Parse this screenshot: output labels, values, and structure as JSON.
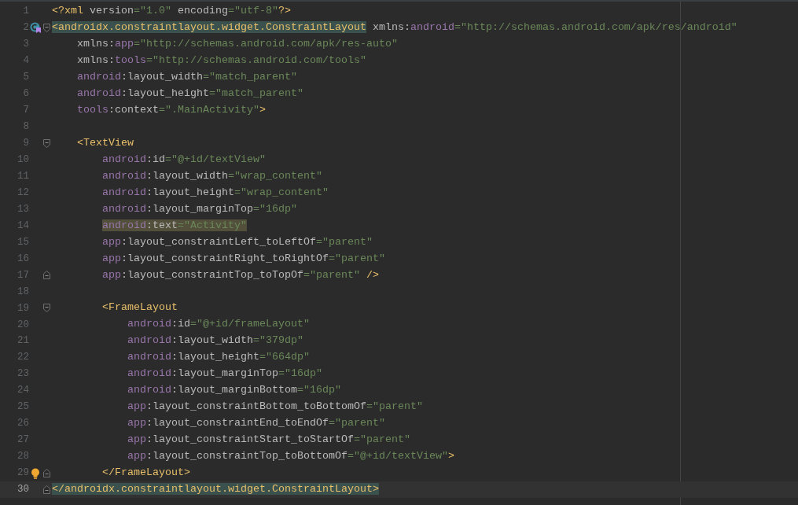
{
  "editor": {
    "lines": [
      {
        "number": "1",
        "current": false,
        "tokens": [
          {
            "kind": "tag",
            "text": "<?xml"
          },
          {
            "kind": "attr",
            "text": " version"
          },
          {
            "kind": "eq",
            "text": "="
          },
          {
            "kind": "str",
            "text": "\"1.0\""
          },
          {
            "kind": "attr",
            "text": " encoding"
          },
          {
            "kind": "eq",
            "text": "="
          },
          {
            "kind": "str",
            "text": "\"utf-8\""
          },
          {
            "kind": "tag",
            "text": "?>"
          }
        ]
      },
      {
        "number": "2",
        "current": false,
        "implemented": true,
        "fold_open": true,
        "tokens": [
          {
            "kind": "tag",
            "text": "<androidx.constraintlayout.widget.ConstraintLayout",
            "matched": true
          },
          {
            "kind": "attr",
            "text": " xmlns:"
          },
          {
            "kind": "ns",
            "text": "android"
          },
          {
            "kind": "eq",
            "text": "="
          },
          {
            "kind": "str",
            "text": "\"http://schemas.android.com/apk/res/android\""
          }
        ]
      },
      {
        "number": "3",
        "current": false,
        "tokens": [
          {
            "kind": "attr",
            "text": "    xmlns:"
          },
          {
            "kind": "ns",
            "text": "app"
          },
          {
            "kind": "eq",
            "text": "="
          },
          {
            "kind": "str",
            "text": "\"http://schemas.android.com/apk/res-auto\""
          }
        ]
      },
      {
        "number": "4",
        "current": false,
        "tokens": [
          {
            "kind": "attr",
            "text": "    xmlns:"
          },
          {
            "kind": "ns",
            "text": "tools"
          },
          {
            "kind": "eq",
            "text": "="
          },
          {
            "kind": "str",
            "text": "\"http://schemas.android.com/tools\""
          }
        ]
      },
      {
        "number": "5",
        "current": false,
        "tokens": [
          {
            "kind": "ns",
            "text": "    android"
          },
          {
            "kind": "attr",
            "text": ":layout_width"
          },
          {
            "kind": "eq",
            "text": "="
          },
          {
            "kind": "str",
            "text": "\"match_parent\""
          }
        ]
      },
      {
        "number": "6",
        "current": false,
        "tokens": [
          {
            "kind": "ns",
            "text": "    android"
          },
          {
            "kind": "attr",
            "text": ":layout_height"
          },
          {
            "kind": "eq",
            "text": "="
          },
          {
            "kind": "str",
            "text": "\"match_parent\""
          }
        ]
      },
      {
        "number": "7",
        "current": false,
        "tokens": [
          {
            "kind": "ns",
            "text": "    tools"
          },
          {
            "kind": "attr",
            "text": ":context"
          },
          {
            "kind": "eq",
            "text": "="
          },
          {
            "kind": "str",
            "text": "\".MainActivity\""
          },
          {
            "kind": "tag",
            "text": ">"
          }
        ]
      },
      {
        "number": "8",
        "current": false
      },
      {
        "number": "9",
        "current": false,
        "fold_open": true,
        "tokens": [
          {
            "kind": "tag",
            "text": "    <TextView"
          }
        ]
      },
      {
        "number": "10",
        "current": false,
        "tokens": [
          {
            "kind": "ns",
            "text": "        android"
          },
          {
            "kind": "attr",
            "text": ":id"
          },
          {
            "kind": "eq",
            "text": "="
          },
          {
            "kind": "str",
            "text": "\"@+id/textView\""
          }
        ]
      },
      {
        "number": "11",
        "current": false,
        "tokens": [
          {
            "kind": "ns",
            "text": "        android"
          },
          {
            "kind": "attr",
            "text": ":layout_width"
          },
          {
            "kind": "eq",
            "text": "="
          },
          {
            "kind": "str",
            "text": "\"wrap_content\""
          }
        ]
      },
      {
        "number": "12",
        "current": false,
        "tokens": [
          {
            "kind": "ns",
            "text": "        android"
          },
          {
            "kind": "attr",
            "text": ":layout_height"
          },
          {
            "kind": "eq",
            "text": "="
          },
          {
            "kind": "str",
            "text": "\"wrap_content\""
          }
        ]
      },
      {
        "number": "13",
        "current": false,
        "tokens": [
          {
            "kind": "ns",
            "text": "        android"
          },
          {
            "kind": "attr",
            "text": ":layout_marginTop"
          },
          {
            "kind": "eq",
            "text": "="
          },
          {
            "kind": "str",
            "text": "\"16dp\""
          }
        ]
      },
      {
        "number": "14",
        "current": false,
        "tokens": [
          {
            "kind": "ns",
            "text": "        android",
            "usage_highlight": true
          },
          {
            "kind": "attr",
            "text": ":text",
            "usage_highlight": true
          },
          {
            "kind": "eq",
            "text": "=",
            "usage_highlight": true
          },
          {
            "kind": "str",
            "text": "\"Activity\"",
            "usage_highlight": true
          }
        ]
      },
      {
        "number": "15",
        "current": false,
        "tokens": [
          {
            "kind": "ns",
            "text": "        app"
          },
          {
            "kind": "attr",
            "text": ":layout_constraintLeft_toLeftOf"
          },
          {
            "kind": "eq",
            "text": "="
          },
          {
            "kind": "str",
            "text": "\"parent\""
          }
        ]
      },
      {
        "number": "16",
        "current": false,
        "tokens": [
          {
            "kind": "ns",
            "text": "        app"
          },
          {
            "kind": "attr",
            "text": ":layout_constraintRight_toRightOf"
          },
          {
            "kind": "eq",
            "text": "="
          },
          {
            "kind": "str",
            "text": "\"parent\""
          }
        ]
      },
      {
        "number": "17",
        "current": false,
        "fold_close": true,
        "tokens": [
          {
            "kind": "ns",
            "text": "        app"
          },
          {
            "kind": "attr",
            "text": ":layout_constraintTop_toTopOf"
          },
          {
            "kind": "eq",
            "text": "="
          },
          {
            "kind": "str",
            "text": "\"parent\""
          },
          {
            "kind": "tag",
            "text": " />"
          }
        ]
      },
      {
        "number": "18",
        "current": false
      },
      {
        "number": "19",
        "current": false,
        "fold_open": true,
        "tokens": [
          {
            "kind": "tag",
            "text": "        <FrameLayout"
          }
        ]
      },
      {
        "number": "20",
        "current": false,
        "tokens": [
          {
            "kind": "ns",
            "text": "            android"
          },
          {
            "kind": "attr",
            "text": ":id"
          },
          {
            "kind": "eq",
            "text": "="
          },
          {
            "kind": "str",
            "text": "\"@+id/frameLayout\""
          }
        ]
      },
      {
        "number": "21",
        "current": false,
        "tokens": [
          {
            "kind": "ns",
            "text": "            android"
          },
          {
            "kind": "attr",
            "text": ":layout_width"
          },
          {
            "kind": "eq",
            "text": "="
          },
          {
            "kind": "str",
            "text": "\"379dp\""
          }
        ]
      },
      {
        "number": "22",
        "current": false,
        "tokens": [
          {
            "kind": "ns",
            "text": "            android"
          },
          {
            "kind": "attr",
            "text": ":layout_height"
          },
          {
            "kind": "eq",
            "text": "="
          },
          {
            "kind": "str",
            "text": "\"664dp\""
          }
        ]
      },
      {
        "number": "23",
        "current": false,
        "tokens": [
          {
            "kind": "ns",
            "text": "            android"
          },
          {
            "kind": "attr",
            "text": ":layout_marginTop"
          },
          {
            "kind": "eq",
            "text": "="
          },
          {
            "kind": "str",
            "text": "\"16dp\""
          }
        ]
      },
      {
        "number": "24",
        "current": false,
        "tokens": [
          {
            "kind": "ns",
            "text": "            android"
          },
          {
            "kind": "attr",
            "text": ":layout_marginBottom"
          },
          {
            "kind": "eq",
            "text": "="
          },
          {
            "kind": "str",
            "text": "\"16dp\""
          }
        ]
      },
      {
        "number": "25",
        "current": false,
        "tokens": [
          {
            "kind": "ns",
            "text": "            app"
          },
          {
            "kind": "attr",
            "text": ":layout_constraintBottom_toBottomOf"
          },
          {
            "kind": "eq",
            "text": "="
          },
          {
            "kind": "str",
            "text": "\"parent\""
          }
        ]
      },
      {
        "number": "26",
        "current": false,
        "tokens": [
          {
            "kind": "ns",
            "text": "            app"
          },
          {
            "kind": "attr",
            "text": ":layout_constraintEnd_toEndOf"
          },
          {
            "kind": "eq",
            "text": "="
          },
          {
            "kind": "str",
            "text": "\"parent\""
          }
        ]
      },
      {
        "number": "27",
        "current": false,
        "tokens": [
          {
            "kind": "ns",
            "text": "            app"
          },
          {
            "kind": "attr",
            "text": ":layout_constraintStart_toStartOf"
          },
          {
            "kind": "eq",
            "text": "="
          },
          {
            "kind": "str",
            "text": "\"parent\""
          }
        ]
      },
      {
        "number": "28",
        "current": false,
        "tokens": [
          {
            "kind": "ns",
            "text": "            app"
          },
          {
            "kind": "attr",
            "text": ":layout_constraintTop_toBottomOf"
          },
          {
            "kind": "eq",
            "text": "="
          },
          {
            "kind": "str",
            "text": "\"@+id/textView\""
          },
          {
            "kind": "tag",
            "text": ">"
          }
        ]
      },
      {
        "number": "29",
        "current": false,
        "intention": true,
        "fold_close": true,
        "tokens": [
          {
            "kind": "tag",
            "text": "        </FrameLayout>"
          }
        ]
      },
      {
        "number": "30",
        "current": true,
        "fold_close": true,
        "tokens": [
          {
            "kind": "tag",
            "text": "</androidx.constraintlayout.widget.ConstraintLayout>",
            "matched": true
          }
        ]
      }
    ]
  }
}
